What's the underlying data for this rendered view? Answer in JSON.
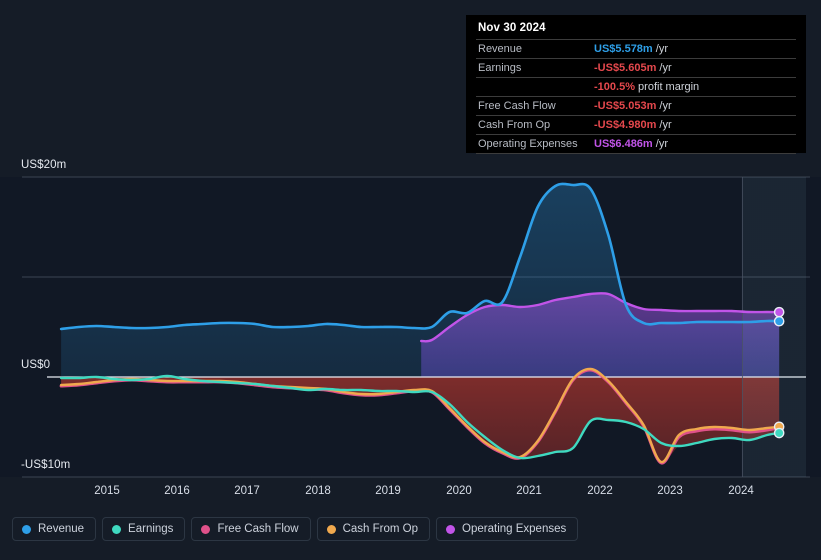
{
  "chart_data": {
    "type": "area",
    "title": "",
    "xlabel": "",
    "ylabel": "",
    "grid": true,
    "legend_position": "bottom",
    "x_ticks": [
      "2015",
      "2016",
      "2017",
      "2018",
      "2019",
      "2020",
      "2021",
      "2022",
      "2023",
      "2024"
    ],
    "y_ticks": [
      "US$20m",
      "US$0",
      "-US$10m"
    ],
    "ylim": [
      -12.0,
      22.5
    ],
    "xlim": [
      2014.55,
      2025.3
    ],
    "currency": "US$",
    "units": "m",
    "forecast_start": "2024.4",
    "series": [
      {
        "name": "Revenue",
        "color": "#2e9fe8",
        "x": [
          2014.75,
          2015.0,
          2015.25,
          2015.5,
          2015.75,
          2016.0,
          2016.25,
          2016.5,
          2016.75,
          2017.0,
          2017.25,
          2017.5,
          2017.75,
          2018.0,
          2018.25,
          2018.5,
          2018.75,
          2019.0,
          2019.25,
          2019.5,
          2019.75,
          2020.0,
          2020.25,
          2020.5,
          2020.75,
          2021.0,
          2021.25,
          2021.5,
          2021.75,
          2022.0,
          2022.25,
          2022.5,
          2022.75,
          2023.0,
          2023.25,
          2023.5,
          2023.75,
          2024.0,
          2024.25,
          2024.5,
          2024.75,
          2024.92
        ],
        "values": [
          4.8,
          5.0,
          5.1,
          5.0,
          4.9,
          4.9,
          5.0,
          5.2,
          5.3,
          5.4,
          5.4,
          5.3,
          5.0,
          5.0,
          5.1,
          5.3,
          5.2,
          5.0,
          5.0,
          5.0,
          4.9,
          5.0,
          6.5,
          6.4,
          7.6,
          7.5,
          12.0,
          17.0,
          19.1,
          19.2,
          18.8,
          14.2,
          7.2,
          5.4,
          5.4,
          5.4,
          5.5,
          5.5,
          5.5,
          5.5,
          5.6,
          5.578
        ]
      },
      {
        "name": "Earnings",
        "color": "#3fd9c0",
        "x": [
          2014.75,
          2015.0,
          2015.25,
          2015.5,
          2015.75,
          2016.0,
          2016.25,
          2016.5,
          2016.75,
          2017.0,
          2017.25,
          2017.5,
          2017.75,
          2018.0,
          2018.25,
          2018.5,
          2018.75,
          2019.0,
          2019.25,
          2019.5,
          2019.75,
          2020.0,
          2020.25,
          2020.5,
          2020.75,
          2021.0,
          2021.25,
          2021.5,
          2021.75,
          2022.0,
          2022.25,
          2022.5,
          2022.75,
          2023.0,
          2023.25,
          2023.5,
          2023.75,
          2024.0,
          2024.25,
          2024.5,
          2024.75,
          2024.92
        ],
        "values": [
          -0.1,
          -0.1,
          0.0,
          -0.2,
          -0.3,
          -0.2,
          0.1,
          -0.2,
          -0.4,
          -0.5,
          -0.6,
          -0.7,
          -0.9,
          -1.1,
          -1.3,
          -1.2,
          -1.3,
          -1.3,
          -1.4,
          -1.4,
          -1.5,
          -1.5,
          -2.7,
          -4.5,
          -6.0,
          -7.3,
          -8.1,
          -7.9,
          -7.5,
          -7.1,
          -4.4,
          -4.3,
          -4.5,
          -5.2,
          -6.6,
          -6.9,
          -6.6,
          -6.2,
          -6.1,
          -6.3,
          -5.8,
          -5.605
        ]
      },
      {
        "name": "Free Cash Flow",
        "color": "#e0518a",
        "x": [
          2014.75,
          2015.0,
          2015.25,
          2015.5,
          2015.75,
          2016.0,
          2016.25,
          2016.5,
          2016.75,
          2017.0,
          2017.25,
          2017.5,
          2017.75,
          2018.0,
          2018.25,
          2018.5,
          2018.75,
          2019.0,
          2019.25,
          2019.5,
          2019.75,
          2020.0,
          2020.25,
          2020.5,
          2020.75,
          2021.0,
          2021.25,
          2021.5,
          2021.75,
          2022.0,
          2022.25,
          2022.5,
          2022.75,
          2023.0,
          2023.25,
          2023.5,
          2023.75,
          2024.0,
          2024.25,
          2024.5,
          2024.75,
          2024.92
        ],
        "values": [
          -0.9,
          -0.8,
          -0.6,
          -0.4,
          -0.3,
          -0.4,
          -0.5,
          -0.5,
          -0.5,
          -0.5,
          -0.6,
          -0.8,
          -1.0,
          -1.1,
          -1.2,
          -1.3,
          -1.6,
          -1.8,
          -1.8,
          -1.6,
          -1.4,
          -1.5,
          -3.2,
          -5.0,
          -6.6,
          -7.6,
          -8.1,
          -6.5,
          -3.5,
          -0.3,
          0.7,
          -0.5,
          -2.6,
          -4.9,
          -8.6,
          -6.0,
          -5.4,
          -5.2,
          -5.3,
          -5.5,
          -5.3,
          -5.053
        ]
      },
      {
        "name": "Cash From Op",
        "color": "#f0a94e",
        "x": [
          2014.75,
          2015.0,
          2015.25,
          2015.5,
          2015.75,
          2016.0,
          2016.25,
          2016.5,
          2016.75,
          2017.0,
          2017.25,
          2017.5,
          2017.75,
          2018.0,
          2018.25,
          2018.5,
          2018.75,
          2019.0,
          2019.25,
          2019.5,
          2019.75,
          2020.0,
          2020.25,
          2020.5,
          2020.75,
          2021.0,
          2021.25,
          2021.5,
          2021.75,
          2022.0,
          2022.25,
          2022.5,
          2022.75,
          2023.0,
          2023.25,
          2023.5,
          2023.75,
          2024.0,
          2024.25,
          2024.5,
          2024.75,
          2024.92
        ],
        "values": [
          -0.8,
          -0.7,
          -0.5,
          -0.3,
          -0.2,
          -0.3,
          -0.4,
          -0.4,
          -0.4,
          -0.4,
          -0.5,
          -0.7,
          -0.9,
          -1.0,
          -1.1,
          -1.2,
          -1.5,
          -1.7,
          -1.7,
          -1.5,
          -1.3,
          -1.4,
          -3.1,
          -4.9,
          -6.5,
          -7.5,
          -8.0,
          -6.4,
          -3.4,
          -0.2,
          0.8,
          -0.4,
          -2.5,
          -4.8,
          -8.5,
          -5.8,
          -5.2,
          -5.0,
          -5.1,
          -5.3,
          -5.1,
          -4.98
        ]
      },
      {
        "name": "Operating Expenses",
        "color": "#c154e8",
        "x": [
          2019.85,
          2020.0,
          2020.25,
          2020.5,
          2020.75,
          2021.0,
          2021.25,
          2021.5,
          2021.75,
          2022.0,
          2022.25,
          2022.5,
          2022.75,
          2023.0,
          2023.25,
          2023.5,
          2023.75,
          2024.0,
          2024.25,
          2024.5,
          2024.75,
          2024.92
        ],
        "values": [
          3.6,
          3.7,
          5.0,
          6.2,
          7.0,
          7.2,
          7.0,
          7.2,
          7.7,
          8.0,
          8.3,
          8.3,
          7.4,
          6.8,
          6.7,
          6.6,
          6.6,
          6.6,
          6.6,
          6.5,
          6.5,
          6.486
        ]
      }
    ]
  },
  "axis": {
    "y": [
      {
        "label": "US$20m",
        "value": 20
      },
      {
        "label": "US$0",
        "value": 0
      },
      {
        "label": "-US$10m",
        "value": -10
      }
    ],
    "x": [
      "2015",
      "2016",
      "2017",
      "2018",
      "2019",
      "2020",
      "2021",
      "2022",
      "2023",
      "2024"
    ]
  },
  "tooltip": {
    "date": "Nov 30 2024",
    "rows": [
      {
        "key": "Revenue",
        "value": "US$5.578m",
        "unit": "/yr",
        "color": "#2e9fe8"
      },
      {
        "key": "Earnings",
        "value": "-US$5.605m",
        "unit": "/yr",
        "color": "#e5484d"
      },
      {
        "key": "",
        "value": "-100.5%",
        "unit": "profit margin",
        "color": "#e5484d"
      },
      {
        "key": "Free Cash Flow",
        "value": "-US$5.053m",
        "unit": "/yr",
        "color": "#e5484d"
      },
      {
        "key": "Cash From Op",
        "value": "-US$4.980m",
        "unit": "/yr",
        "color": "#e5484d"
      },
      {
        "key": "Operating Expenses",
        "value": "US$6.486m",
        "unit": "/yr",
        "color": "#c154e8"
      }
    ]
  },
  "legend": {
    "items": [
      {
        "label": "Revenue",
        "color": "#2e9fe8"
      },
      {
        "label": "Earnings",
        "color": "#3fd9c0"
      },
      {
        "label": "Free Cash Flow",
        "color": "#e0518a"
      },
      {
        "label": "Cash From Op",
        "color": "#f0a94e"
      },
      {
        "label": "Operating Expenses",
        "color": "#c154e8"
      }
    ]
  }
}
